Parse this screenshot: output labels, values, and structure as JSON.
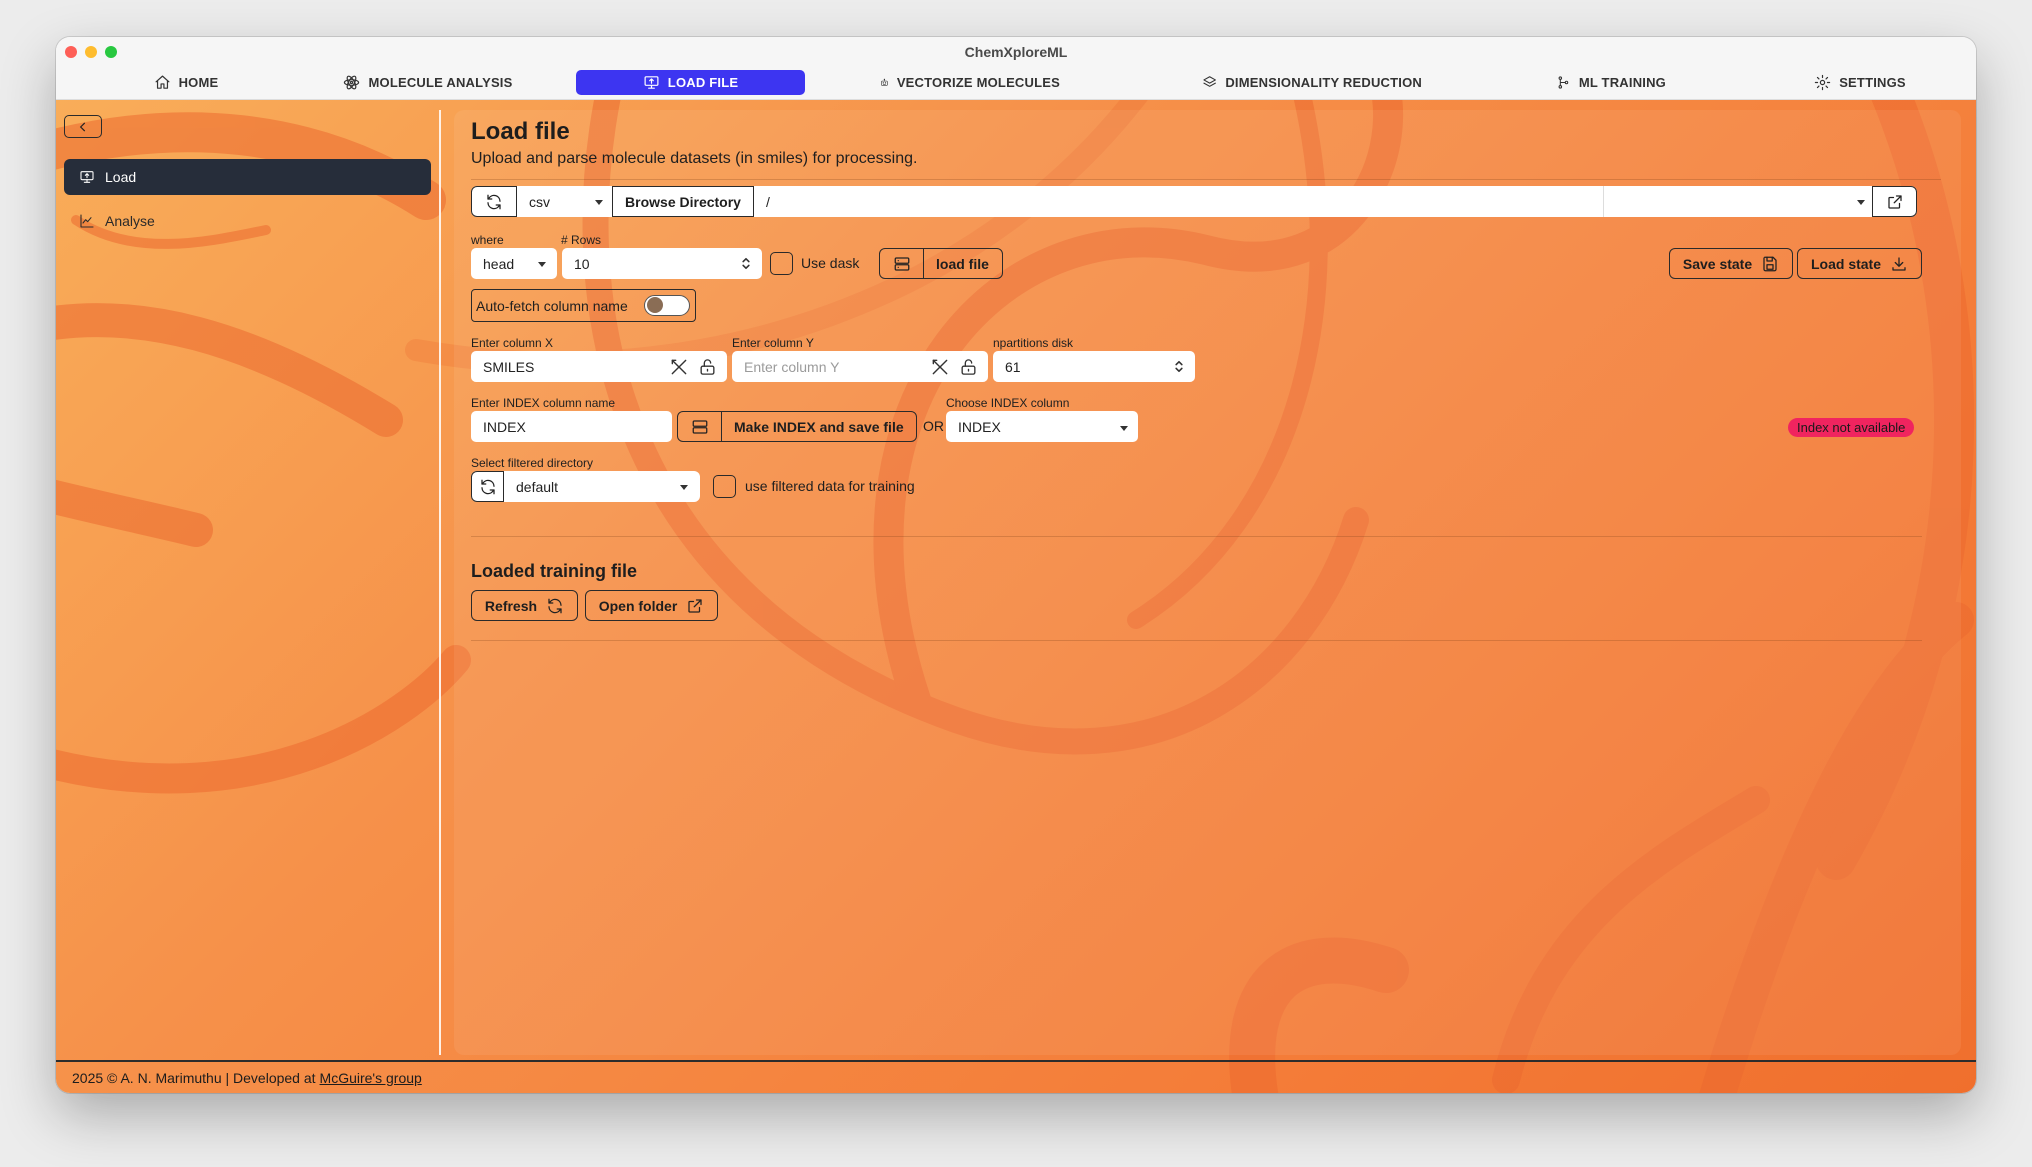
{
  "window": {
    "title": "ChemXploreML"
  },
  "nav": {
    "tabs": [
      {
        "label": "HOME",
        "icon": "home-icon",
        "active": false
      },
      {
        "label": "MOLECULE ANALYSIS",
        "icon": "atom-icon",
        "active": false
      },
      {
        "label": "LOAD FILE",
        "icon": "monitor-upload-icon",
        "active": true
      },
      {
        "label": "VECTORIZE MOLECULES",
        "icon": "robot-icon",
        "active": false
      },
      {
        "label": "DIMENSIONALITY REDUCTION",
        "icon": "layers-icon",
        "active": false
      },
      {
        "label": "ML TRAINING",
        "icon": "pipeline-icon",
        "active": false
      },
      {
        "label": "SETTINGS",
        "icon": "gear-icon",
        "active": false
      }
    ],
    "accent_color": "#3d35f1"
  },
  "sidebar": {
    "items": [
      {
        "label": "Load",
        "icon": "monitor-upload-icon",
        "active": true
      },
      {
        "label": "Analyse",
        "icon": "chart-line-icon",
        "active": false
      }
    ]
  },
  "main": {
    "title": "Load file",
    "subtitle": "Upload and parse molecule datasets (in smiles) for processing.",
    "file_bar": {
      "filetype": "csv",
      "browse_label": "Browse Directory",
      "path_value": "/",
      "file_select_value": ""
    },
    "where": {
      "label": "where",
      "value": "head"
    },
    "rows": {
      "label": "# Rows",
      "value": "10"
    },
    "use_dask": {
      "label": "Use dask",
      "checked": false
    },
    "load_file_label": "load file",
    "save_state_label": "Save state",
    "load_state_label": "Load state",
    "auto_fetch": {
      "label": "Auto-fetch column name",
      "on": false
    },
    "column_x": {
      "label": "Enter column X",
      "value": "SMILES"
    },
    "column_y": {
      "label": "Enter column Y",
      "placeholder": "Enter column Y",
      "value": ""
    },
    "npartitions": {
      "label": "npartitions disk",
      "value": "61"
    },
    "index_name": {
      "label": "Enter INDEX column name",
      "value": "INDEX"
    },
    "make_index_label": "Make INDEX and save file",
    "or_label": "OR",
    "choose_index": {
      "label": "Choose INDEX column",
      "value": "INDEX"
    },
    "index_status": {
      "text": "Index not available",
      "color": "#f0245f"
    },
    "filtered_dir": {
      "label": "Select filtered directory",
      "value": "default"
    },
    "use_filtered": {
      "label": "use filtered data for training",
      "checked": false
    },
    "loaded_section": {
      "title": "Loaded training file",
      "refresh_label": "Refresh",
      "open_folder_label": "Open folder"
    }
  },
  "footer": {
    "text": "2025 © A. N. Marimuthu | Developed at",
    "link": "McGuire's group"
  }
}
